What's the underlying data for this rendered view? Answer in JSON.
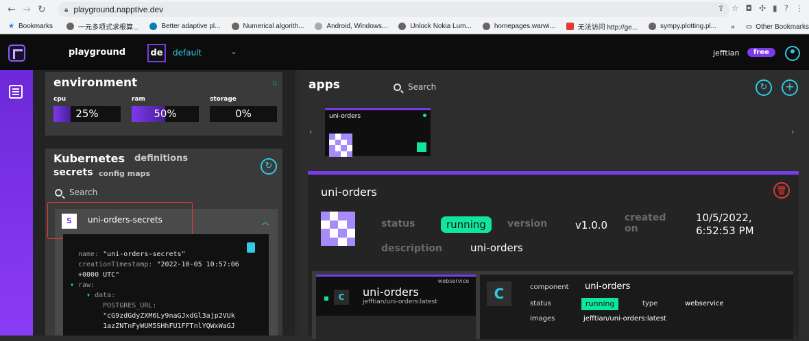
{
  "browser": {
    "url": "playground.napptive.dev",
    "bookmarks": [
      {
        "label": "Bookmarks",
        "icon": "star-icon"
      },
      {
        "label": "一元多项式求根算...",
        "icon": "globe-icon"
      },
      {
        "label": "Better adaptive pl...",
        "icon": "globe-icon"
      },
      {
        "label": "Numerical algorith...",
        "icon": "globe-icon"
      },
      {
        "label": "Android, Windows...",
        "icon": "globe-icon"
      },
      {
        "label": "Unlock Nokia Lum...",
        "icon": "globe-icon"
      },
      {
        "label": "homepages.warwi...",
        "icon": "globe-icon"
      },
      {
        "label": "无法访问 http://ge...",
        "icon": "globe-icon"
      },
      {
        "label": "sympy.plotting.pl...",
        "icon": "globe-icon"
      }
    ],
    "more": "»",
    "other_bookmarks": "Other Bookmarks"
  },
  "header": {
    "brand": "playground",
    "workspace_initials": "de",
    "workspace_name": "default",
    "user": "jefftian",
    "plan": "free"
  },
  "environment": {
    "title": "environment",
    "metrics": [
      {
        "label": "cpu",
        "value": "25%",
        "fraction": 0.25
      },
      {
        "label": "ram",
        "value": "50%",
        "fraction": 0.5
      },
      {
        "label": "storage",
        "value": "0%",
        "fraction": 0
      }
    ]
  },
  "kubernetes": {
    "title": "Kubernetes",
    "tab_definitions": "definitions",
    "tab_secrets": "secrets",
    "tab_config_maps": "config maps",
    "search_placeholder": "Search",
    "secret": {
      "icon_letter": "S",
      "name": "uni-orders-secrets",
      "yaml": {
        "name_key": "name:",
        "name_val": "\"uni-orders-secrets\"",
        "ts_key": "creationTimestamp:",
        "ts_val": "\"2022-10-05 10:57:06",
        "ts_val2": "+0000 UTC\"",
        "raw_key": "raw:",
        "data_key": "data:",
        "url_key": "POSTGRES_URL:",
        "url_val1": "\"cG9zdGdyZXM6Ly9naGJxdGl3ajp2VUk",
        "url_val2": "1azZNTnFyWUM5SHhFU1FFTnlYQWxWaGJ"
      }
    }
  },
  "apps": {
    "title": "apps",
    "search_placeholder": "Search",
    "carousel_card": {
      "name": "uni-orders"
    },
    "detail": {
      "name": "uni-orders",
      "status_label": "status",
      "status_value": "running",
      "version_label": "version",
      "version_value": "v1.0.0",
      "created_label": "created on",
      "created_line1": "10/5/2022,",
      "created_line2": "6:52:53 PM",
      "description_label": "description",
      "description_value": "uni-orders"
    },
    "component_card": {
      "letter": "C",
      "name": "uni-orders",
      "image": "jefftian/uni-orders:latest",
      "type_tag": "webservice"
    },
    "component_info": {
      "letter": "C",
      "component_label": "component",
      "component_value": "uni-orders",
      "status_label": "status",
      "status_value": "running",
      "type_label": "type",
      "type_value": "webservice",
      "images_label": "images",
      "images_value": "jefftian/uni-orders:latest"
    }
  },
  "colors": {
    "accent": "#7c3aed",
    "teal": "#32c9e6",
    "running": "#10e5a0",
    "danger": "#e53935"
  }
}
